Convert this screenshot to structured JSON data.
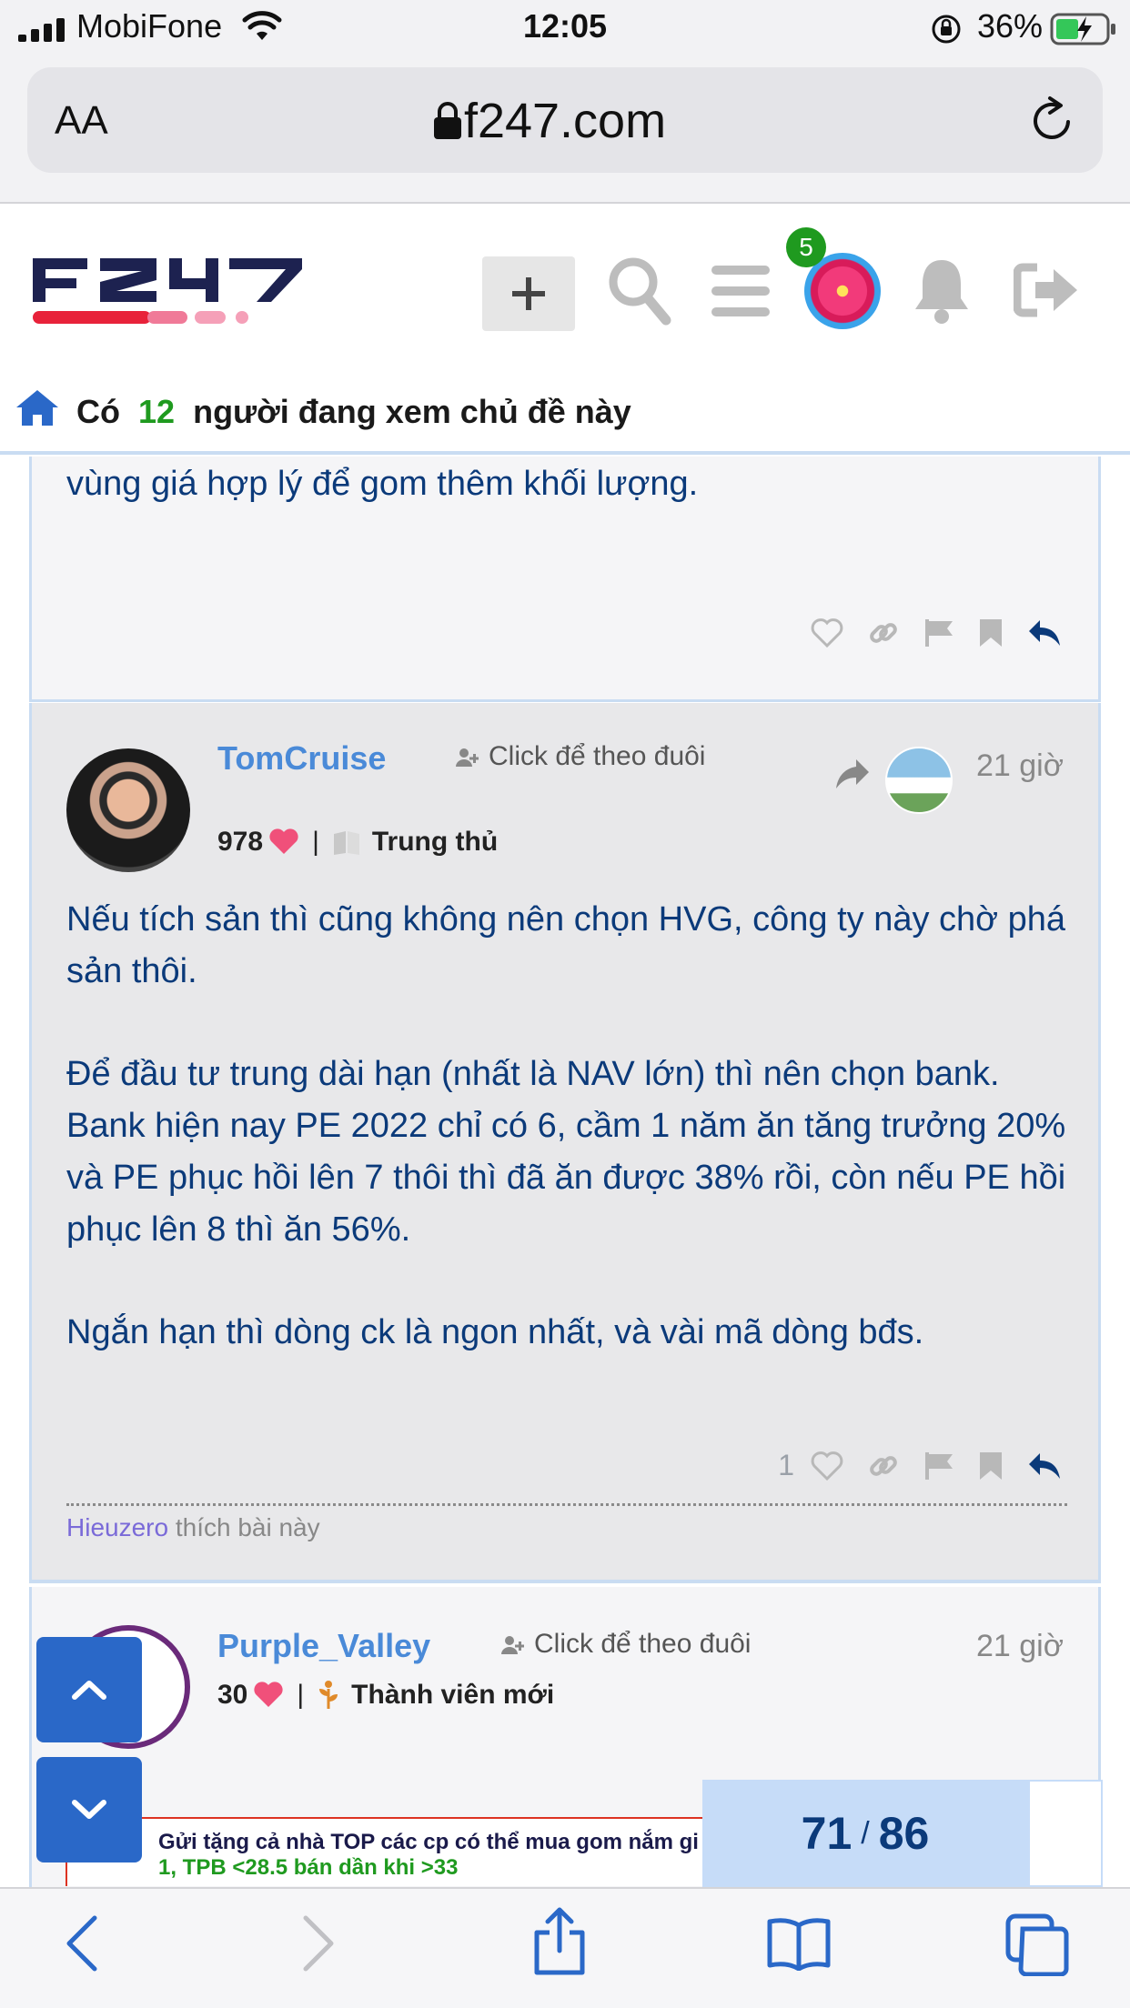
{
  "status_bar": {
    "carrier": "MobiFone",
    "time": "12:05",
    "battery_percent": "36%"
  },
  "browser": {
    "text_size_label": "AA",
    "url": "f247.com"
  },
  "site": {
    "notification_count": "5"
  },
  "topic_bar": {
    "prefix": "Có",
    "viewer_count": "12",
    "suffix": "người đang xem chủ đề này"
  },
  "posts": [
    {
      "text": "vùng giá hợp lý để gom thêm khối lượng."
    },
    {
      "username": "TomCruise",
      "follow_label": "Click để theo đuôi",
      "time_ago": "21 giờ",
      "reputation": "978",
      "rank": "Trung thủ",
      "paragraphs": [
        "Nếu tích sản thì cũng không nên chọn HVG, công ty này chờ phá sản thôi.",
        "Để đầu tư trung dài hạn (nhất là NAV lớn) thì nên chọn bank. Bank hiện nay PE 2022 chỉ có 6, cầm 1 năm ăn tăng trưởng 20% và PE phục hồi lên 7 thôi thì đã ăn được 38% rồi, còn nếu PE hồi phục lên 8 thì ăn 56%.",
        "Ngắn hạn thì dòng ck là ngon nhất, và vài mã dòng bđs."
      ],
      "like_count": "1",
      "liked_by": "Hieuzero",
      "liked_suffix": "thích bài này"
    },
    {
      "username": "Purple_Valley",
      "follow_label": "Click để theo đuôi",
      "time_ago": "21 giờ",
      "reputation": "30",
      "rank": "Thành viên mới",
      "signature_line1": "Gửi tặng cả nhà TOP các cp có thể mua gom nắm gi",
      "signature_line2": "1, TPB <28.5 bán dần khi >33"
    }
  ],
  "progress": {
    "current": "71",
    "total": "86"
  },
  "colors": {
    "accent_blue": "#2a68c8",
    "post_text": "#0b3a7a",
    "username": "#4a8ad8",
    "online_green": "#1f9a1f",
    "heart": "#f0507a"
  }
}
